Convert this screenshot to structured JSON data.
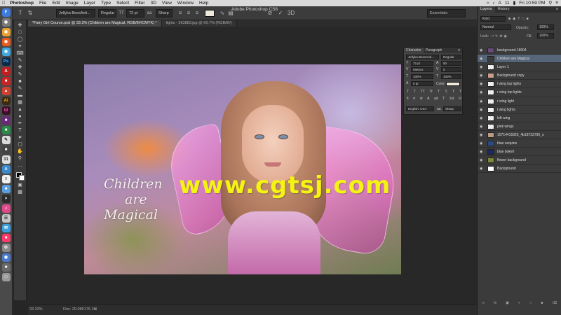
{
  "menubar": {
    "app": "Photoshop",
    "items": [
      "File",
      "Edit",
      "Image",
      "Layer",
      "Type",
      "Select",
      "Filter",
      "3D",
      "View",
      "Window",
      "Help"
    ],
    "status": [
      "A",
      "11"
    ],
    "clock": "Fri 10:59 PM"
  },
  "window_title": "Adobe Photoshop CS6",
  "options": {
    "font_family": "Jellyka BeesAnti...",
    "font_style": "Regular",
    "font_size": "72 pt",
    "antialias": "Sharp",
    "workspace": "Essentials"
  },
  "doc_tabs": [
    {
      "label": "*Fairy Girl Course.psd @ 33.3% (Children are Magical, RGB/8#/CMYK) *",
      "active": true
    },
    {
      "label": "lights - 363883.jpg @ 66.7% (RGB/8#)",
      "active": false
    }
  ],
  "artwork": {
    "script_lines": [
      "Children",
      "are",
      "Magical"
    ],
    "watermark": "www.cgtsj.com"
  },
  "status": {
    "zoom": "33.33%",
    "doc": "Doc: 20.0M/176.1M"
  },
  "character": {
    "tabs": [
      "Character",
      "Paragraph"
    ],
    "font": "Jellyka BeesAnti...",
    "style": "Regular",
    "size": "72 pt",
    "leading": "50",
    "kerning": "Metrics",
    "tracking": "0",
    "vscale": "100%",
    "hscale": "100%",
    "baseline": "0 pt",
    "color_label": "Color:",
    "glyphs": [
      "T",
      "T",
      "TT",
      "Tr",
      "T'",
      "T,",
      "T",
      "T"
    ],
    "glyphs2": [
      "fi",
      "ơ",
      "st",
      "A",
      "ad",
      "T",
      "1st",
      "½"
    ],
    "language": "English: USA",
    "aa": "Sharp",
    "color": "#efe9dc"
  },
  "layers_panel": {
    "tabs": [
      "Layers",
      "History"
    ],
    "kind": "Kind",
    "blend": "Normal",
    "opacity_label": "Opacity:",
    "opacity": "100%",
    "lock_label": "Lock:",
    "fill_label": "Fill:",
    "fill": "100%",
    "layers": [
      {
        "name": "background-18904",
        "selected": false
      },
      {
        "name": "Children are Magical",
        "selected": true
      },
      {
        "name": "Layer 1",
        "selected": false
      },
      {
        "name": "Background copy",
        "selected": false
      },
      {
        "name": "l wing top lights",
        "selected": false
      },
      {
        "name": "r wing top lights",
        "selected": false
      },
      {
        "name": "r wing light",
        "selected": false
      },
      {
        "name": "l wing lights",
        "selected": false
      },
      {
        "name": "left wing",
        "selected": false
      },
      {
        "name": "pink wings",
        "selected": false
      },
      {
        "name": "10714415925_4b18733790_o",
        "selected": false
      },
      {
        "name": "blue sequins",
        "selected": false
      },
      {
        "name": "blue bokeh",
        "selected": false
      },
      {
        "name": "flower background",
        "selected": false
      },
      {
        "name": "Background",
        "selected": false
      }
    ]
  }
}
